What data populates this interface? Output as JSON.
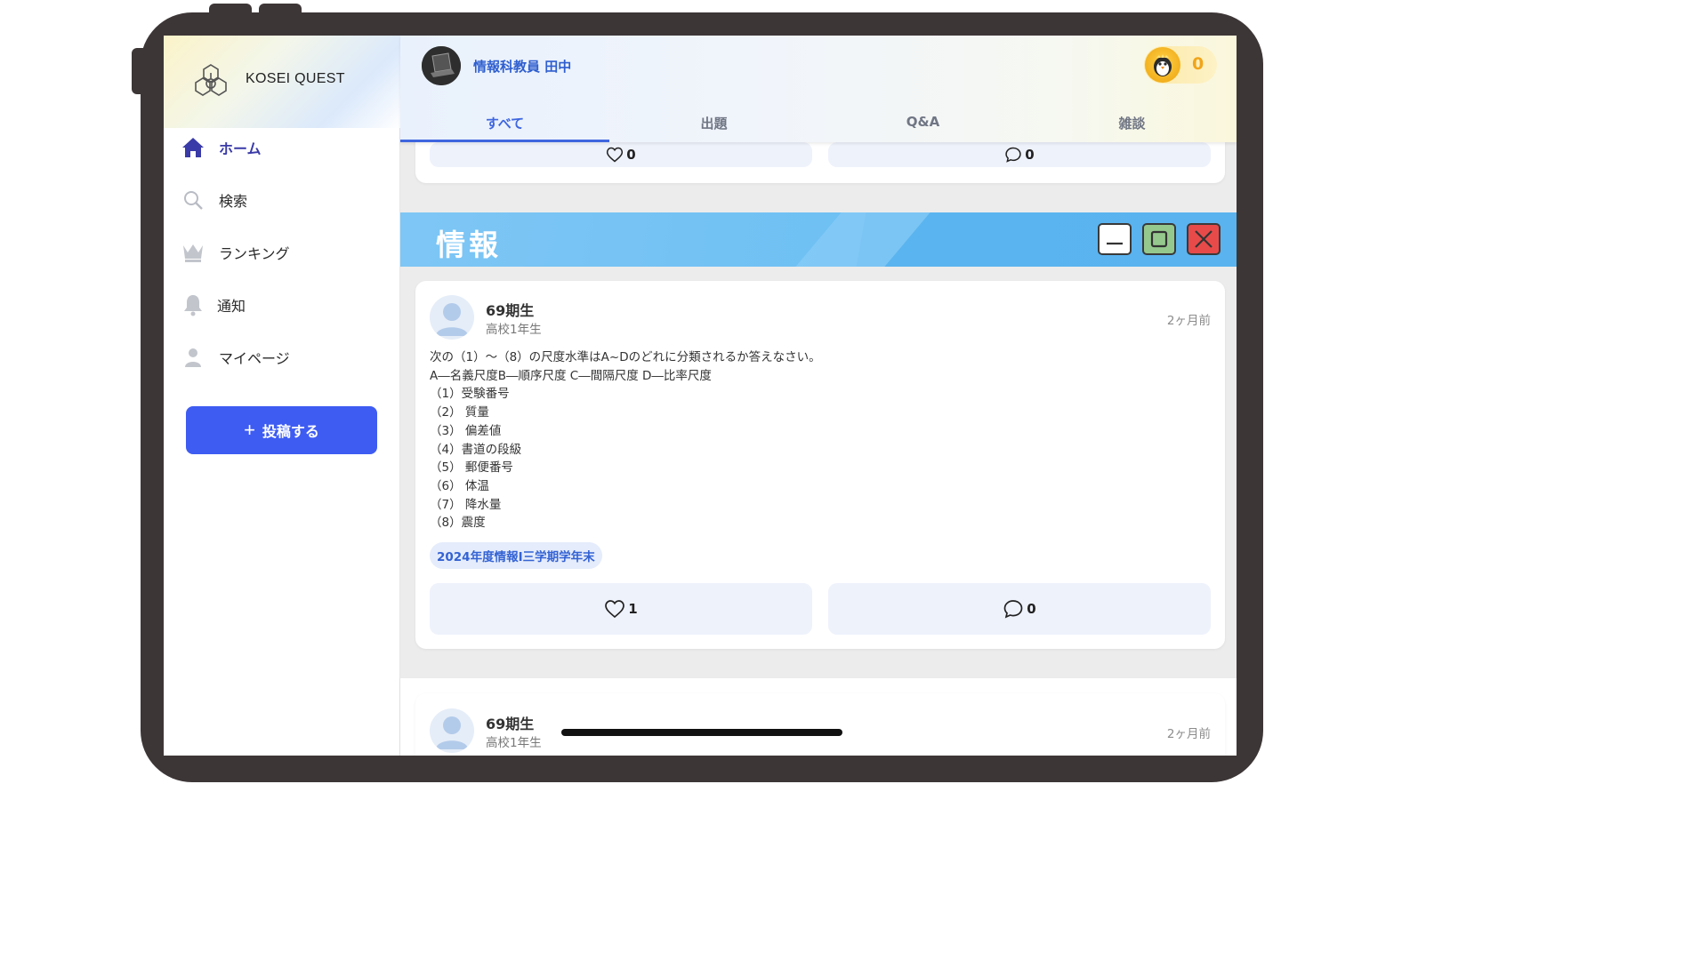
{
  "app": {
    "brand": "KOSEI QUEST"
  },
  "sidebar": {
    "items": [
      {
        "label": "ホーム",
        "icon": "home-icon",
        "active": true
      },
      {
        "label": "検索",
        "icon": "search-icon",
        "active": false
      },
      {
        "label": "ランキング",
        "icon": "crown-icon",
        "active": false
      },
      {
        "label": "通知",
        "icon": "bell-icon",
        "active": false
      },
      {
        "label": "マイページ",
        "icon": "user-icon",
        "active": false
      }
    ],
    "post_button": "投稿する"
  },
  "header": {
    "user_name": "情報科教員 田中",
    "coins": "0",
    "tabs": [
      {
        "label": "すべて",
        "active": true
      },
      {
        "label": "出題",
        "active": false
      },
      {
        "label": "Q&A",
        "active": false
      },
      {
        "label": "雑談",
        "active": false
      }
    ]
  },
  "previous_post": {
    "likes": "0",
    "comments": "0"
  },
  "category_banner": {
    "title": "情報"
  },
  "posts": [
    {
      "author": "69期生",
      "grade": "高校1年生",
      "time": "2ヶ月前",
      "body": [
        "次の（1）～（8）の尺度水準はA~Dのどれに分類されるか答えなさい。",
        "A―名義尺度B―順序尺度 C―間隔尺度 D―比率尺度",
        "（1）受験番号",
        "（2） 質量",
        "（3） 偏差値",
        "（4）書道の段級",
        "（5） 郵便番号",
        "（6） 体温",
        "（7） 降水量",
        "（8）震度"
      ],
      "tag": "2024年度情報Ⅰ三学期学年末",
      "likes": "1",
      "comments": "0"
    },
    {
      "author": "69期生",
      "grade": "高校1年生",
      "time": "2ヶ月前"
    }
  ],
  "colors": {
    "accent": "#3e5cf2",
    "tab_active": "#3f66e0",
    "banner": "#6ec0f3",
    "coin": "#f0a51a"
  }
}
